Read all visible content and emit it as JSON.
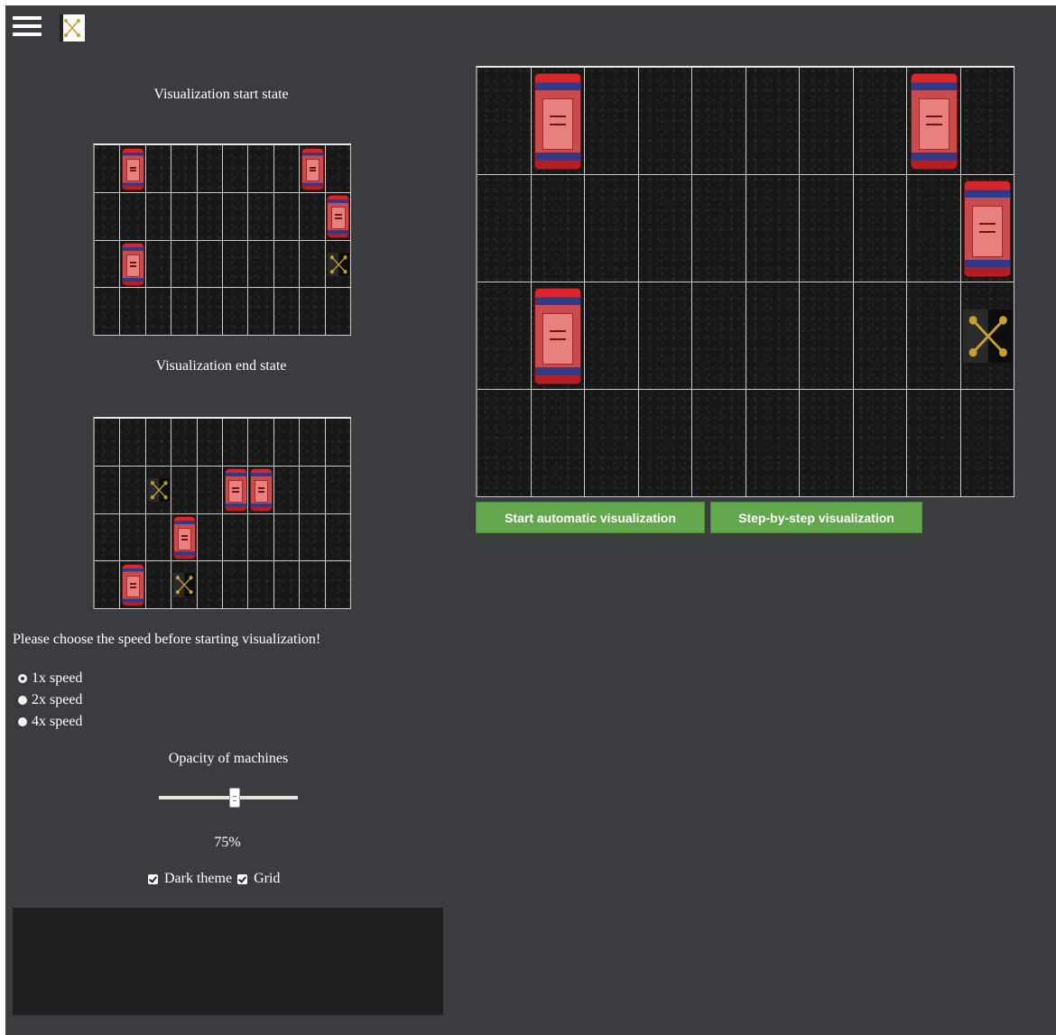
{
  "header": {
    "menu_icon": "hamburger-menu-icon",
    "logo_icon": "robot-logo-icon"
  },
  "start_state": {
    "caption": "Visualization start state",
    "rows": 4,
    "cols": 10,
    "cars": [
      [
        0,
        1
      ],
      [
        0,
        8
      ],
      [
        1,
        9
      ],
      [
        2,
        1
      ]
    ],
    "robots": [
      [
        2,
        9
      ]
    ]
  },
  "end_state": {
    "caption": "Visualization end state",
    "rows": 4,
    "cols": 10,
    "cars": [
      [
        1,
        5
      ],
      [
        1,
        6
      ],
      [
        2,
        3
      ],
      [
        3,
        1
      ]
    ],
    "robots": [
      [
        1,
        2
      ],
      [
        3,
        3
      ]
    ]
  },
  "main_grid": {
    "rows": 4,
    "cols": 10,
    "cars": [
      [
        0,
        1
      ],
      [
        0,
        8
      ],
      [
        1,
        9
      ],
      [
        2,
        1
      ]
    ],
    "robots": [
      [
        2,
        9
      ]
    ]
  },
  "buttons": {
    "start_auto": "Start automatic visualization",
    "step_by_step": "Step-by-step visualization"
  },
  "speed": {
    "prompt": "Please choose the speed before starting visualization!",
    "options": [
      "1x speed",
      "2x speed",
      "4x speed"
    ],
    "selected": "1x speed"
  },
  "opacity": {
    "title": "Opacity of machines",
    "value_label": "75%",
    "value": 0.75
  },
  "toggles": {
    "dark_theme": {
      "label": "Dark theme",
      "checked": true
    },
    "grid": {
      "label": "Grid",
      "checked": true
    }
  },
  "colors": {
    "accent_button": "#64a84e",
    "background": "#3a3c40",
    "console": "#1e1f21"
  }
}
